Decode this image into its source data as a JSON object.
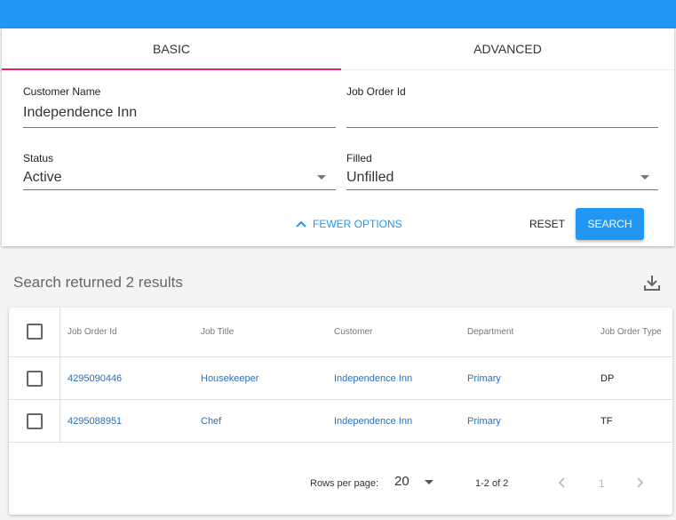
{
  "tabs": [
    {
      "label": "BASIC"
    },
    {
      "label": "ADVANCED"
    }
  ],
  "form": {
    "customer_name": {
      "label": "Customer Name",
      "value": "Independence Inn"
    },
    "job_order_id": {
      "label": "Job Order Id",
      "value": ""
    },
    "status": {
      "label": "Status",
      "value": "Active"
    },
    "filled": {
      "label": "Filled",
      "value": "Unfilled"
    },
    "fewer_options": "FEWER OPTIONS",
    "reset": "RESET",
    "search": "SEARCH"
  },
  "results_text": "Search returned 2 results",
  "table": {
    "headers": [
      "Job Order Id",
      "Job Title",
      "Customer",
      "Department",
      "Job Order Type"
    ],
    "rows": [
      [
        "4295090446",
        "Housekeeper",
        "Independence Inn",
        "Primary",
        "DP"
      ],
      [
        "4295088951",
        "Chef",
        "Independence Inn",
        "Primary",
        "TF"
      ]
    ]
  },
  "pagination": {
    "rows_per_page_label": "Rows per page:",
    "rows_per_page": "20",
    "range": "1-2 of 2",
    "page": "1"
  },
  "colors": {
    "primary": "#2196f3",
    "tab_indicator": "#e91e63",
    "link": "#2a6ebb"
  }
}
